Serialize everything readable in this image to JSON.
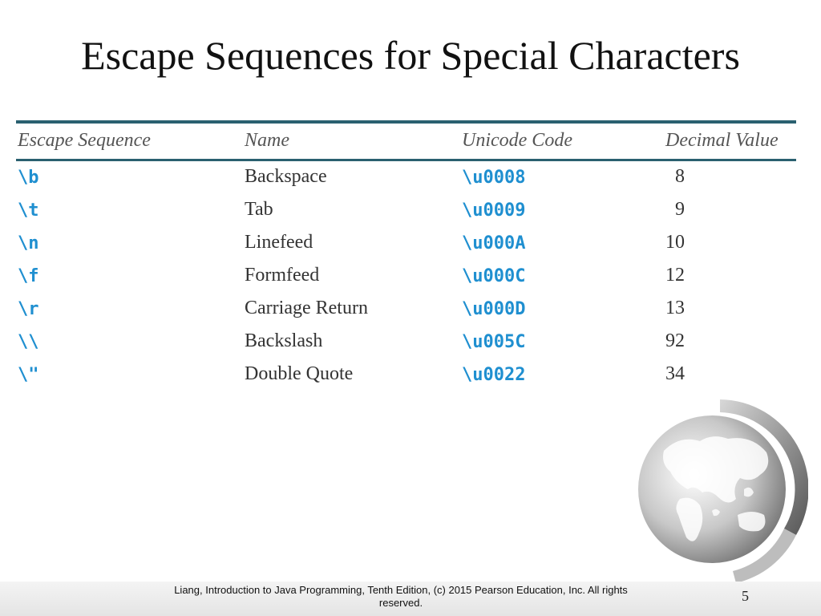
{
  "slide": {
    "title": "Escape Sequences for Special Characters",
    "page_number": "5",
    "footer": "Liang, Introduction to Java Programming, Tenth Edition, (c) 2015 Pearson Education, Inc. All rights reserved."
  },
  "table": {
    "headers": [
      "Escape Sequence",
      "Name",
      "Unicode Code",
      "Decimal Value"
    ],
    "rows": [
      [
        "\\b",
        "Backspace",
        "\\u0008",
        "8"
      ],
      [
        "\\t",
        "Tab",
        "\\u0009",
        "9"
      ],
      [
        "\\n",
        "Linefeed",
        "\\u000A",
        "10"
      ],
      [
        "\\f",
        "Formfeed",
        "\\u000C",
        "12"
      ],
      [
        "\\r",
        "Carriage Return",
        "\\u000D",
        "13"
      ],
      [
        "\\\\",
        "Backslash",
        "\\u005C",
        "92"
      ],
      [
        "\\\"",
        "Double Quote",
        "\\u0022",
        "34"
      ]
    ]
  },
  "colors": {
    "rule": "#2a6070",
    "code": "#1f8fd0"
  },
  "decoration": {
    "icon": "globe-icon"
  }
}
